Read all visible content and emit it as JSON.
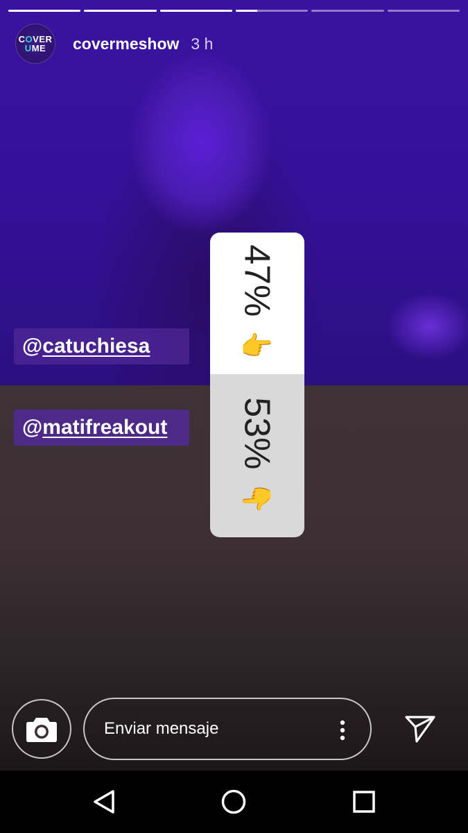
{
  "story": {
    "progress_segments": [
      1,
      1,
      1,
      0.3,
      0,
      0
    ],
    "username": "covermeshow",
    "time": "3 h",
    "avatar_text": {
      "line1_a": "C",
      "line1_b": "VER",
      "line2_a": "U",
      "line2_b": "ME"
    }
  },
  "mentions": [
    {
      "at": "@",
      "handle": "catuchiesa"
    },
    {
      "at": "@",
      "handle": "matifreakout"
    }
  ],
  "poll": {
    "options": [
      {
        "percent": "47%",
        "value": 0.47,
        "emoji": "👆"
      },
      {
        "percent": "53%",
        "value": 0.53,
        "emoji": "👇"
      }
    ]
  },
  "reply_bar": {
    "placeholder": "Enviar mensaje"
  },
  "icons": {
    "camera": "camera-icon",
    "more": "more-vertical-icon",
    "send": "send-icon",
    "back": "nav-back-icon",
    "home": "nav-home-icon",
    "recents": "nav-recents-icon"
  },
  "colors": {
    "top_tint": "#3a12a0",
    "bottom_tint": "#3d3034",
    "mention_bg": "#50289a",
    "poll_top": "#ffffff",
    "poll_bottom": "#d9d9d9"
  }
}
